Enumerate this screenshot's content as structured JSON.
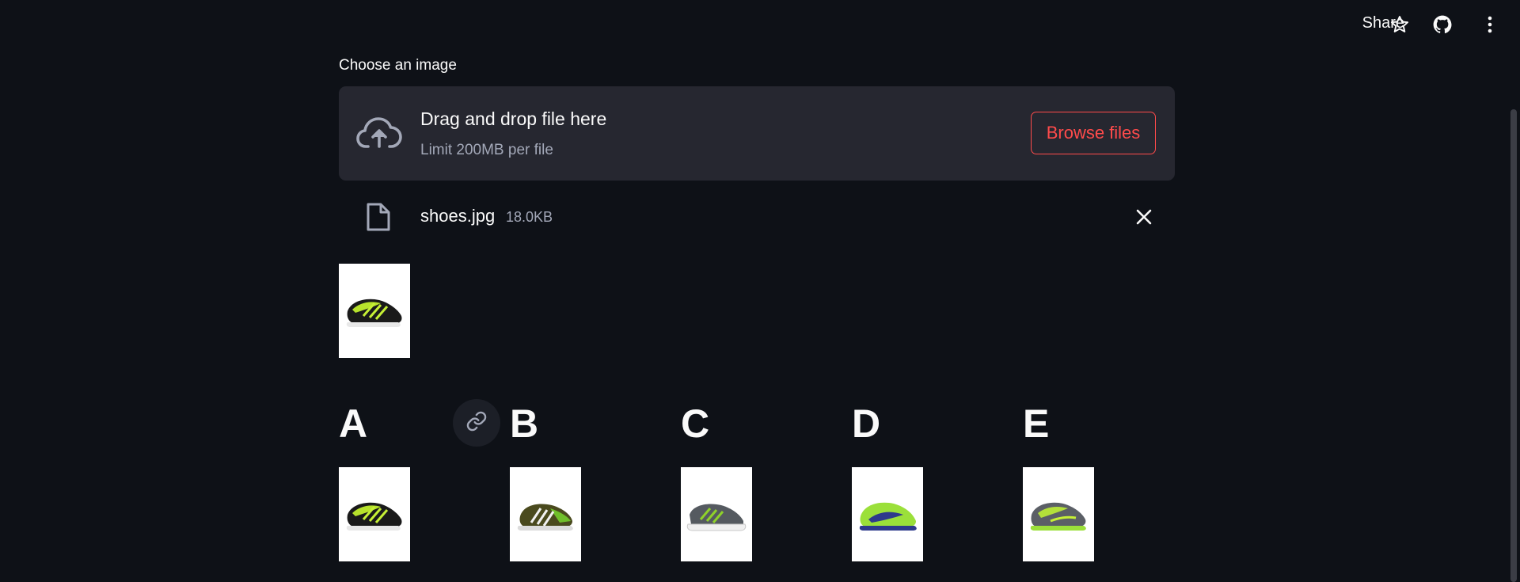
{
  "header": {
    "share_label": "Share",
    "icons": [
      "star-icon",
      "github-icon",
      "kebab-menu-icon"
    ]
  },
  "uploader": {
    "label": "Choose an image",
    "drop_title": "Drag and drop file here",
    "drop_limit": "Limit 200MB per file",
    "browse_label": "Browse files",
    "accent_color": "#ff4b4b"
  },
  "uploaded_file": {
    "name": "shoes.jpg",
    "size": "18.0KB"
  },
  "results": {
    "columns": [
      {
        "label": "A"
      },
      {
        "label": "B"
      },
      {
        "label": "C"
      },
      {
        "label": "D"
      },
      {
        "label": "E"
      }
    ]
  },
  "colors": {
    "background": "#0e1117",
    "panel": "#262730",
    "text": "#fafafa",
    "muted": "#a3a8b8"
  }
}
